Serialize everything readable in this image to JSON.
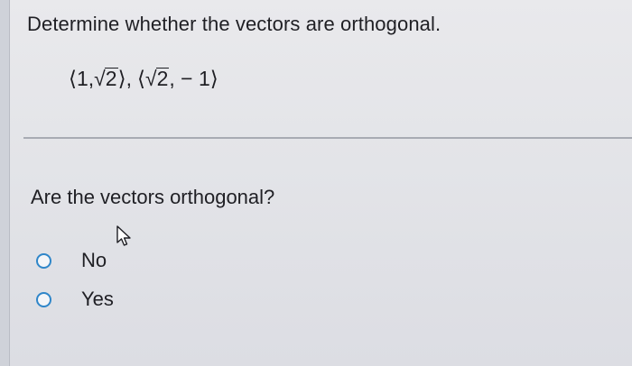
{
  "question": {
    "title": "Determine whether the vectors are orthogonal.",
    "vector1": {
      "open": "⟨1,",
      "radicand": "2",
      "close": "⟩"
    },
    "separator": ",",
    "vector2": {
      "open": "⟨",
      "radicand": "2",
      "tail": ", − 1⟩"
    }
  },
  "prompt": "Are the vectors orthogonal?",
  "options": [
    {
      "label": "No",
      "selected": false
    },
    {
      "label": "Yes",
      "selected": false
    }
  ],
  "colors": {
    "radio_border": "#2f86c9",
    "text": "#1f1f24"
  },
  "icons": {
    "cursor": "mouse-pointer-icon",
    "radical": "square-root-sign"
  }
}
